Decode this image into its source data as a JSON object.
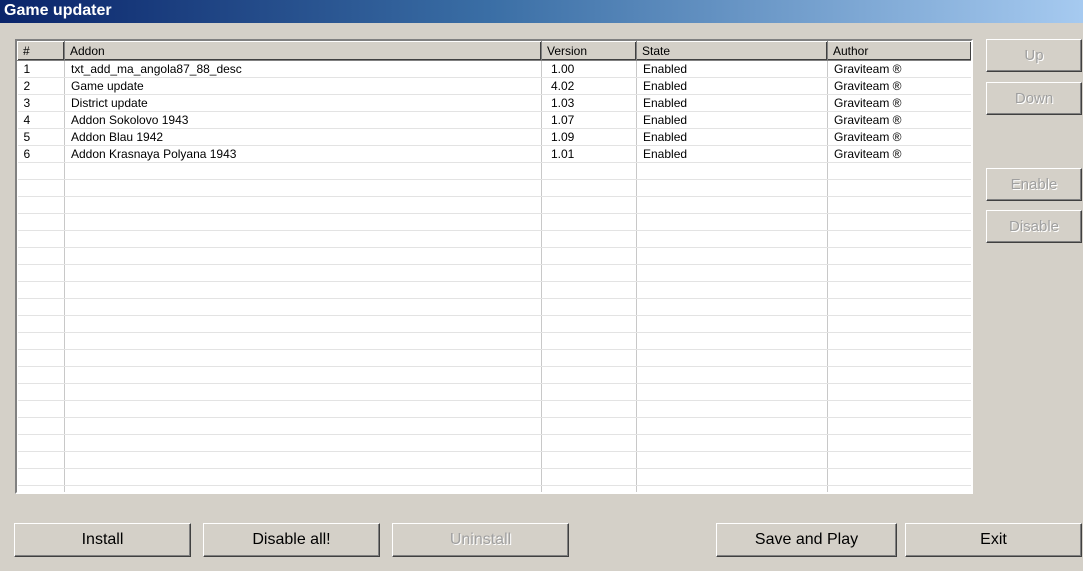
{
  "window": {
    "title": "Game updater"
  },
  "table": {
    "columns": [
      "#",
      "Addon",
      "Version",
      "State",
      "Author"
    ],
    "rows": [
      [
        "1",
        "txt_add_ma_angola87_88_desc",
        "1.00",
        "Enabled",
        "Graviteam ®"
      ],
      [
        "2",
        "Game update",
        "4.02",
        "Enabled",
        "Graviteam ®"
      ],
      [
        "3",
        "District update",
        "1.03",
        "Enabled",
        "Graviteam ®"
      ],
      [
        "4",
        "Addon Sokolovo 1943",
        "1.07",
        "Enabled",
        "Graviteam ®"
      ],
      [
        "5",
        "Addon Blau 1942",
        "1.09",
        "Enabled",
        "Graviteam ®"
      ],
      [
        "6",
        "Addon Krasnaya Polyana 1943",
        "1.01",
        "Enabled",
        "Graviteam ®"
      ]
    ]
  },
  "side_buttons": {
    "up": "Up",
    "down": "Down",
    "enable": "Enable",
    "disable": "Disable"
  },
  "bottom_buttons": {
    "install": "Install",
    "disable_all": "Disable all!",
    "uninstall": "Uninstall",
    "save_and_play": "Save and Play",
    "exit": "Exit"
  }
}
